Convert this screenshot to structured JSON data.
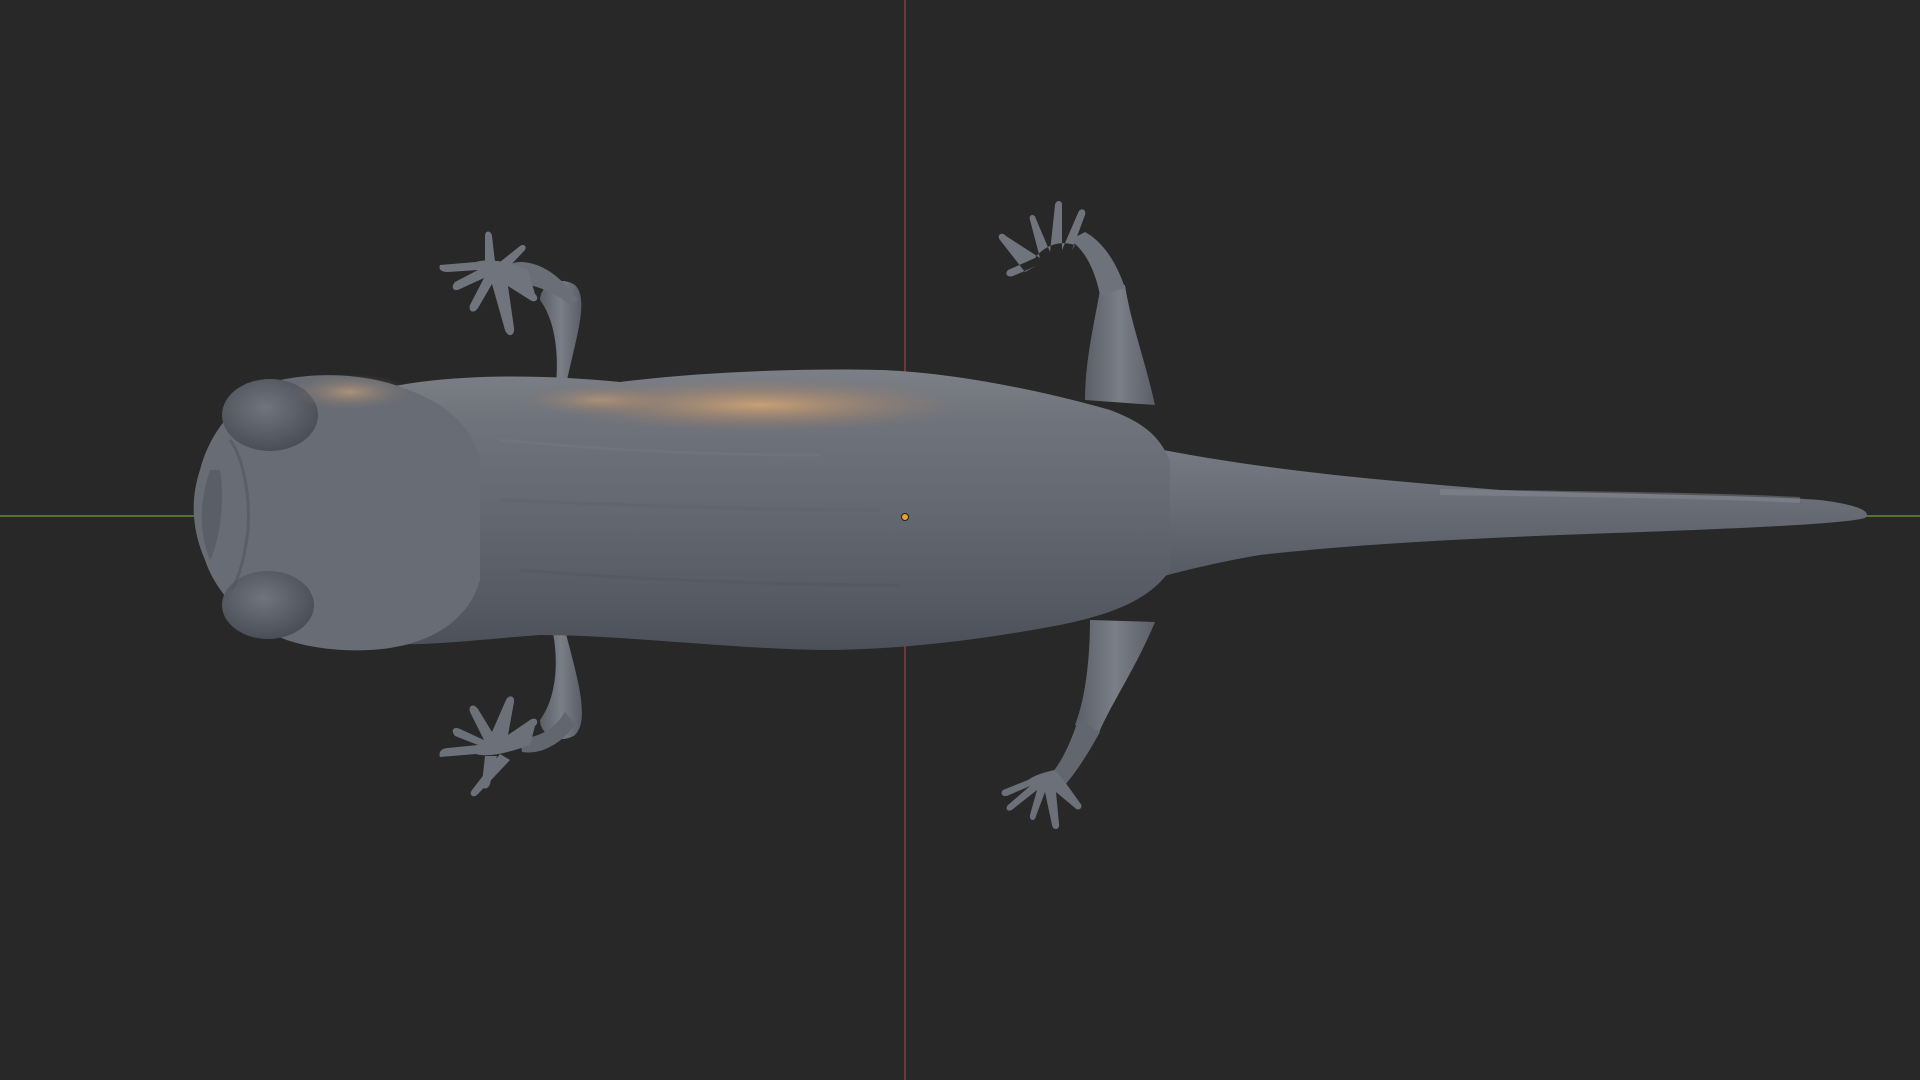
{
  "viewport": {
    "background_color": "#282828",
    "axis_x_color": "#5e8c2f",
    "axis_y_color": "#8c3a3a",
    "origin_marker_color": "#f0a020",
    "model_base_color": "#6b7079",
    "model_highlight_color": "#c49a6a",
    "model_shadow_color": "#4a4e56"
  },
  "scene": {
    "object": "salamander-mesh",
    "view": "top"
  }
}
